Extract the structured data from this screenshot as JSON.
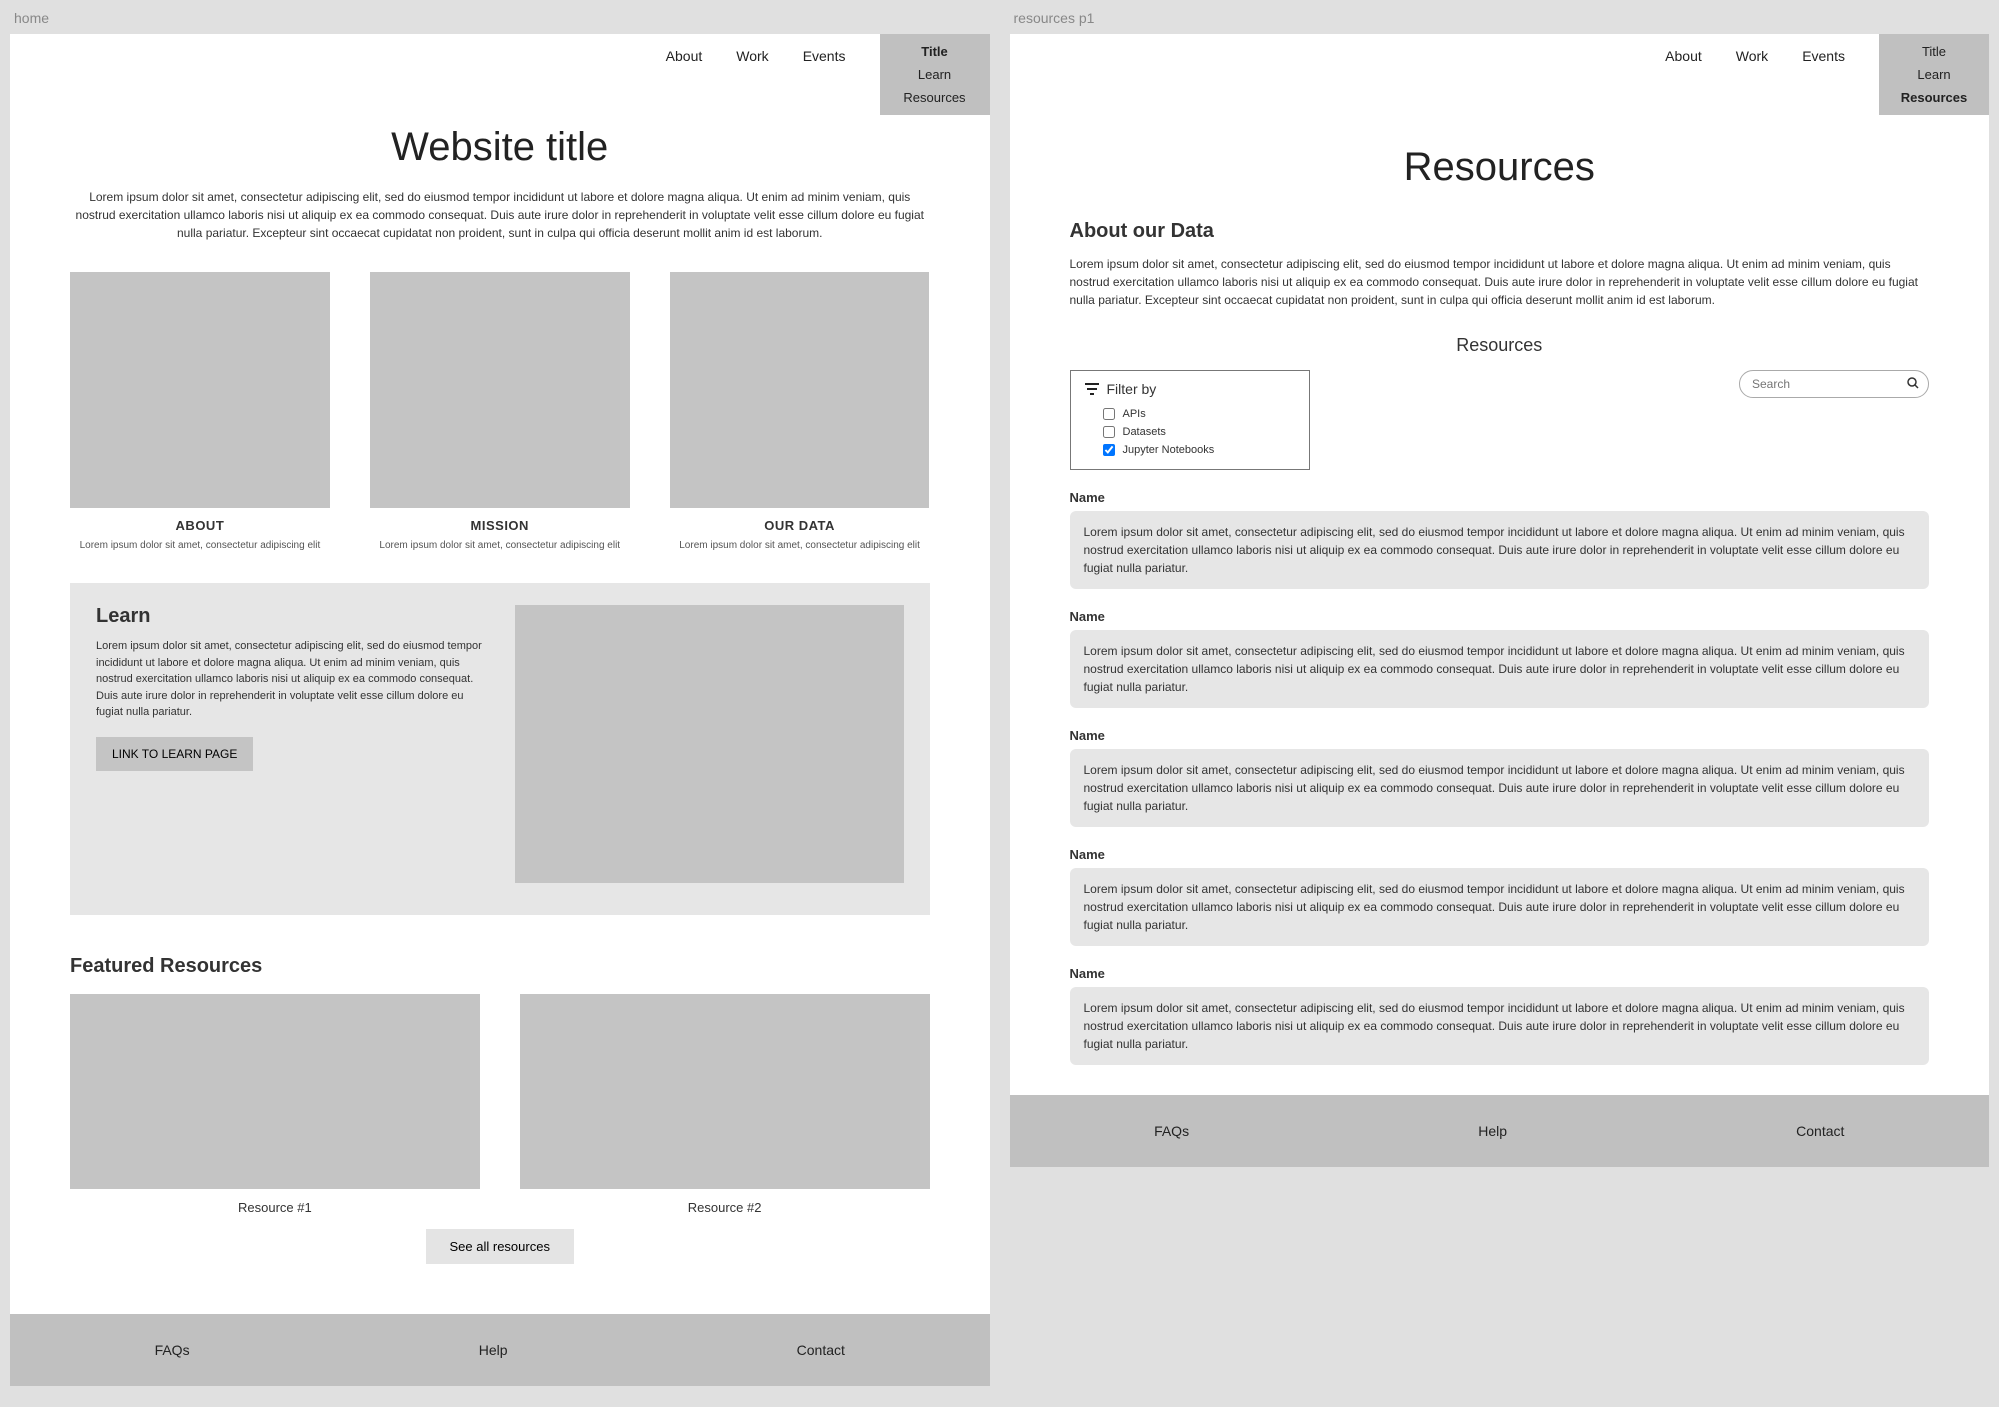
{
  "frames": {
    "home_label": "home",
    "resources_label": "resources p1"
  },
  "nav": {
    "about": "About",
    "work": "Work",
    "events": "Events",
    "sub_title": "Title",
    "sub_learn": "Learn",
    "sub_resources": "Resources"
  },
  "home": {
    "title": "Website title",
    "intro": "Lorem ipsum dolor sit amet, consectetur adipiscing elit, sed do eiusmod tempor incididunt ut labore et dolore magna aliqua. Ut enim ad minim veniam, quis nostrud exercitation ullamco laboris nisi ut aliquip ex ea commodo consequat. Duis aute irure dolor in reprehenderit in voluptate velit esse cillum dolore eu fugiat nulla pariatur. Excepteur sint occaecat cupidatat non proident, sunt in culpa qui officia deserunt mollit anim id est laborum.",
    "cards": [
      {
        "title": "ABOUT",
        "desc": "Lorem ipsum dolor sit amet, consectetur adipiscing elit"
      },
      {
        "title": "MISSION",
        "desc": "Lorem ipsum dolor sit amet, consectetur adipiscing elit"
      },
      {
        "title": "OUR DATA",
        "desc": "Lorem ipsum dolor sit amet, consectetur adipiscing elit"
      }
    ],
    "learn": {
      "heading": "Learn",
      "body": "Lorem ipsum dolor sit amet, consectetur adipiscing elit, sed do eiusmod tempor incididunt ut labore et dolore magna aliqua. Ut enim ad minim veniam, quis nostrud exercitation ullamco laboris nisi ut aliquip ex ea commodo consequat. Duis aute irure dolor in reprehenderit in voluptate velit esse cillum dolore eu fugiat nulla pariatur.",
      "button": "LINK TO LEARN PAGE"
    },
    "featured": {
      "heading": "Featured Resources",
      "items": [
        {
          "label": "Resource #1"
        },
        {
          "label": "Resource #2"
        }
      ],
      "see_all": "See all resources"
    }
  },
  "resources": {
    "title": "Resources",
    "about_heading": "About our Data",
    "about_body": "Lorem ipsum dolor sit amet, consectetur adipiscing elit, sed do eiusmod tempor incididunt ut labore et dolore magna aliqua. Ut enim ad minim veniam, quis nostrud exercitation ullamco laboris nisi ut aliquip ex ea commodo consequat. Duis aute irure dolor in reprehenderit in voluptate velit esse cillum dolore eu fugiat nulla pariatur. Excepteur sint occaecat cupidatat non proident, sunt in culpa qui officia deserunt mollit anim id est laborum.",
    "subheading": "Resources",
    "filter_label": "Filter by",
    "filter_options": [
      {
        "label": "APIs",
        "checked": false
      },
      {
        "label": "Datasets",
        "checked": false
      },
      {
        "label": "Jupyter Notebooks",
        "checked": true
      }
    ],
    "search_placeholder": "Search",
    "items": [
      {
        "name": "Name",
        "desc": "Lorem ipsum dolor sit amet, consectetur adipiscing elit, sed do eiusmod tempor incididunt ut labore et dolore magna aliqua. Ut enim ad minim veniam, quis nostrud exercitation ullamco laboris nisi ut aliquip ex ea commodo consequat. Duis aute irure dolor in reprehenderit in voluptate velit esse cillum dolore eu fugiat nulla pariatur."
      },
      {
        "name": "Name",
        "desc": "Lorem ipsum dolor sit amet, consectetur adipiscing elit, sed do eiusmod tempor incididunt ut labore et dolore magna aliqua. Ut enim ad minim veniam, quis nostrud exercitation ullamco laboris nisi ut aliquip ex ea commodo consequat. Duis aute irure dolor in reprehenderit in voluptate velit esse cillum dolore eu fugiat nulla pariatur."
      },
      {
        "name": "Name",
        "desc": "Lorem ipsum dolor sit amet, consectetur adipiscing elit, sed do eiusmod tempor incididunt ut labore et dolore magna aliqua. Ut enim ad minim veniam, quis nostrud exercitation ullamco laboris nisi ut aliquip ex ea commodo consequat. Duis aute irure dolor in reprehenderit in voluptate velit esse cillum dolore eu fugiat nulla pariatur."
      },
      {
        "name": "Name",
        "desc": "Lorem ipsum dolor sit amet, consectetur adipiscing elit, sed do eiusmod tempor incididunt ut labore et dolore magna aliqua. Ut enim ad minim veniam, quis nostrud exercitation ullamco laboris nisi ut aliquip ex ea commodo consequat. Duis aute irure dolor in reprehenderit in voluptate velit esse cillum dolore eu fugiat nulla pariatur."
      },
      {
        "name": "Name",
        "desc": "Lorem ipsum dolor sit amet, consectetur adipiscing elit, sed do eiusmod tempor incididunt ut labore et dolore magna aliqua. Ut enim ad minim veniam, quis nostrud exercitation ullamco laboris nisi ut aliquip ex ea commodo consequat. Duis aute irure dolor in reprehenderit in voluptate velit esse cillum dolore eu fugiat nulla pariatur."
      }
    ]
  },
  "footer": {
    "faqs": "FAQs",
    "help": "Help",
    "contact": "Contact"
  }
}
